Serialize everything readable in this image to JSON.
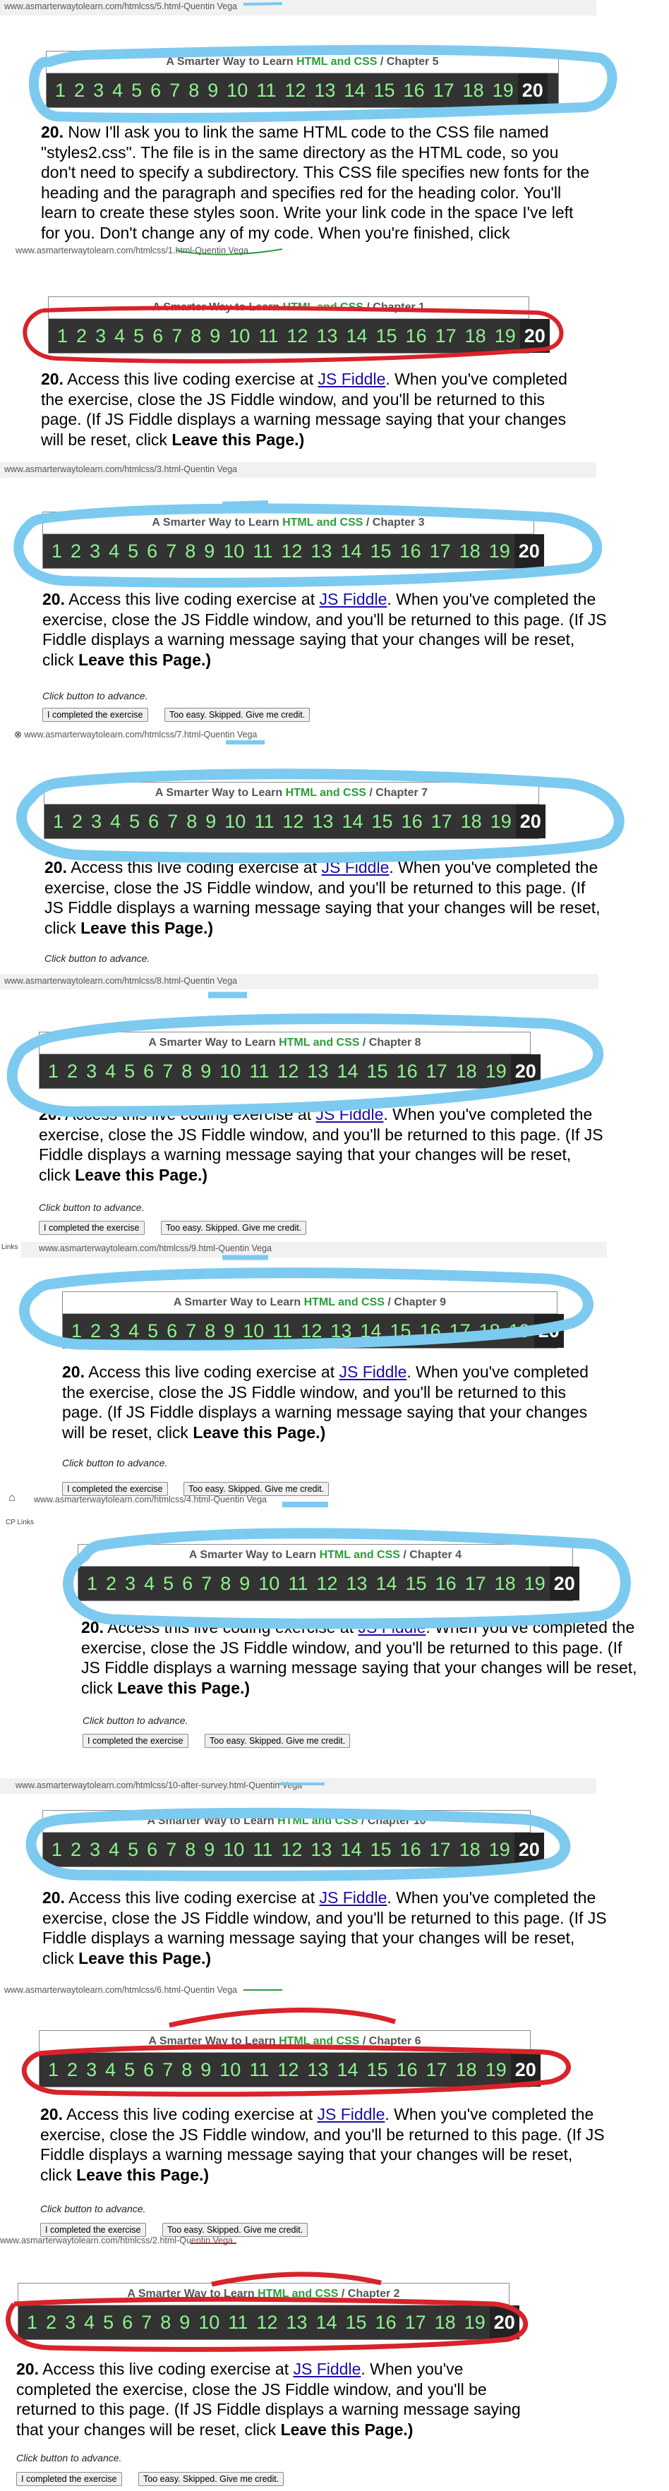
{
  "colors": {
    "blue_marker": "#7ccaf0",
    "red_marker": "#d9232a",
    "nav_bg": "#333333",
    "nav_link": "#8ef28e",
    "title_green": "#2a9d3a"
  },
  "common": {
    "title_prefix": "A Smarter Way to Learn ",
    "title_highlight": "HTML and CSS",
    "title_sep": "  /  ",
    "nav_numbers": [
      "1",
      "2",
      "3",
      "4",
      "5",
      "6",
      "7",
      "8",
      "9",
      "10",
      "11",
      "12",
      "13",
      "14",
      "15",
      "16",
      "17",
      "18",
      "19",
      "20"
    ],
    "ex_num": "20.",
    "ex_text_1": " Access this live coding exercise at ",
    "ex_link": "JS Fiddle",
    "ex_text_2": ". When you've completed the exercise, close the JS Fiddle window, and you'll be returned to this page. (If JS Fiddle displays a warning message saying that your changes will be reset, click ",
    "ex_bold": "Leave this Page.)",
    "advance": "Click button to advance.",
    "btn_done": "I completed the exercise",
    "btn_skip": "Too easy. Skipped. Give me credit.",
    "links_label": "Links",
    "cp_links_label": "CP Links",
    "home_icon": "home-icon"
  },
  "screens": [
    {
      "url": "www.asmarterwaytolearn.com/htmlcss/5.html",
      "author": "-Quentin Vega",
      "chapter": "Chapter 5",
      "text": " Now I'll ask you to link the same HTML code to the CSS file named \"styles2.css\". The file is in the same directory as the HTML code, so you don't need to specify a subdirectory. This CSS file specifies new fonts for the heading and the paragraph and specifies red for the heading color. You'll learn to create these styles soon. Write your link code in the space I've left for you. Don't change any of my code. When you're finished, click",
      "marker": "blue"
    },
    {
      "url": "www.asmarterwaytolearn.com/htmlcss/1.html",
      "author": "-Quentin Vega",
      "chapter": "Chapter 1",
      "marker": "red"
    },
    {
      "url": "www.asmarterwaytolearn.com/htmlcss/3.html",
      "author": "-Quentin Vega",
      "chapter": "Chapter 3",
      "marker": "blue"
    },
    {
      "url": "www.asmarterwaytolearn.com/htmlcss/7.html",
      "author": "-Quentin Vega",
      "chapter": "Chapter 7",
      "marker": "blue"
    },
    {
      "url": "www.asmarterwaytolearn.com/htmlcss/8.html",
      "author": "-Quentin Vega",
      "chapter": "Chapter 8",
      "marker": "blue"
    },
    {
      "url": "www.asmarterwaytolearn.com/htmlcss/9.html",
      "author": "-Quentin Vega",
      "chapter": "Chapter 9",
      "marker": "blue"
    },
    {
      "url": "www.asmarterwaytolearn.com/htmlcss/4.html",
      "author": "-Quentin Vega",
      "chapter": "Chapter 4",
      "marker": "blue"
    },
    {
      "url": "www.asmarterwaytolearn.com/htmlcss/10-after-survey.html",
      "author": "-Quentin Vega",
      "chapter": "Chapter 10",
      "marker": "blue"
    },
    {
      "url": "www.asmarterwaytolearn.com/htmlcss/6.html",
      "author": "-Quentin Vega",
      "chapter": "Chapter 6",
      "marker": "red"
    },
    {
      "url": "www.asmarterwaytolearn.com/htmlcss/2.html",
      "author": "-Quentin Vega",
      "chapter": "Chapter 2",
      "marker": "red"
    }
  ]
}
